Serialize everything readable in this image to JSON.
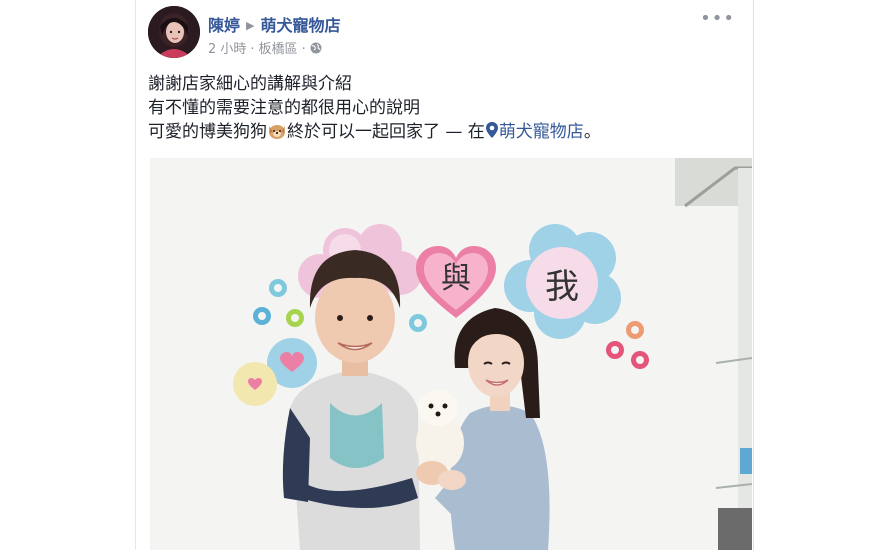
{
  "post": {
    "author": "陳婷",
    "page": "萌犬寵物店",
    "time": "2 小時",
    "location": "板橋區",
    "lines": [
      "謝謝店家細心的講解與介紹",
      "有不懂的需要注意的都很用心的說明"
    ],
    "line3_prefix": "可愛的博美狗狗",
    "line3_suffix": "終於可以一起回家了 — 在",
    "checkin_place": "萌犬寵物店",
    "line3_end": "。",
    "emoji": "dog-face-icon",
    "more_label": "•••"
  },
  "photo": {
    "wall_chars": [
      "與",
      "我"
    ]
  },
  "colors": {
    "link": "#365899",
    "meta": "#90949c",
    "wall": "#f4f5f3"
  }
}
